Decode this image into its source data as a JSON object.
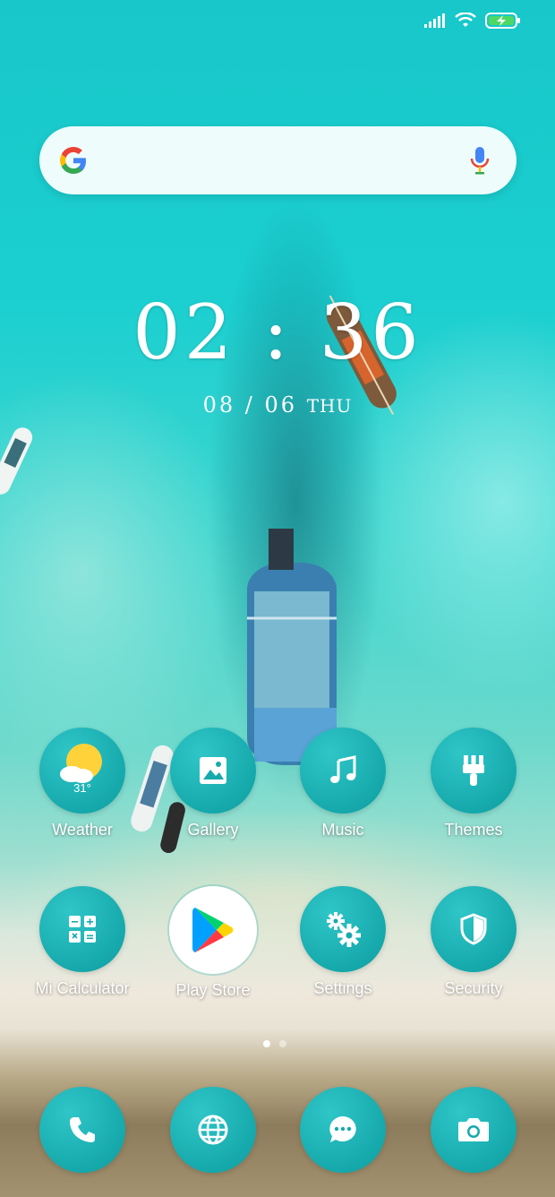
{
  "status": {
    "signal_icon": "signal-icon",
    "wifi_icon": "wifi-icon",
    "battery_icon": "battery-charging-icon"
  },
  "search": {
    "g_icon": "google-g-icon",
    "mic_icon": "microphone-icon"
  },
  "clock": {
    "time": "02 : 36",
    "date": "08 / 06",
    "weekday": "THU"
  },
  "apps_row1": [
    {
      "label": "Weather",
      "icon": "weather-sun-cloud-icon",
      "temp": "31°"
    },
    {
      "label": "Gallery",
      "icon": "gallery-icon"
    },
    {
      "label": "Music",
      "icon": "music-note-icon"
    },
    {
      "label": "Themes",
      "icon": "paintbrush-icon"
    }
  ],
  "apps_row2": [
    {
      "label": "Mi Calculator",
      "icon": "calculator-icon"
    },
    {
      "label": "Play Store",
      "icon": "play-store-icon"
    },
    {
      "label": "Settings",
      "icon": "gears-icon"
    },
    {
      "label": "Security",
      "icon": "shield-icon"
    }
  ],
  "page_indicator": {
    "pages": 2,
    "active": 1
  },
  "dock": [
    {
      "icon": "phone-icon"
    },
    {
      "icon": "browser-globe-icon"
    },
    {
      "icon": "messages-icon"
    },
    {
      "icon": "camera-icon"
    }
  ],
  "colors": {
    "accent": "#17aaad",
    "battery_green": "#4cd964"
  }
}
